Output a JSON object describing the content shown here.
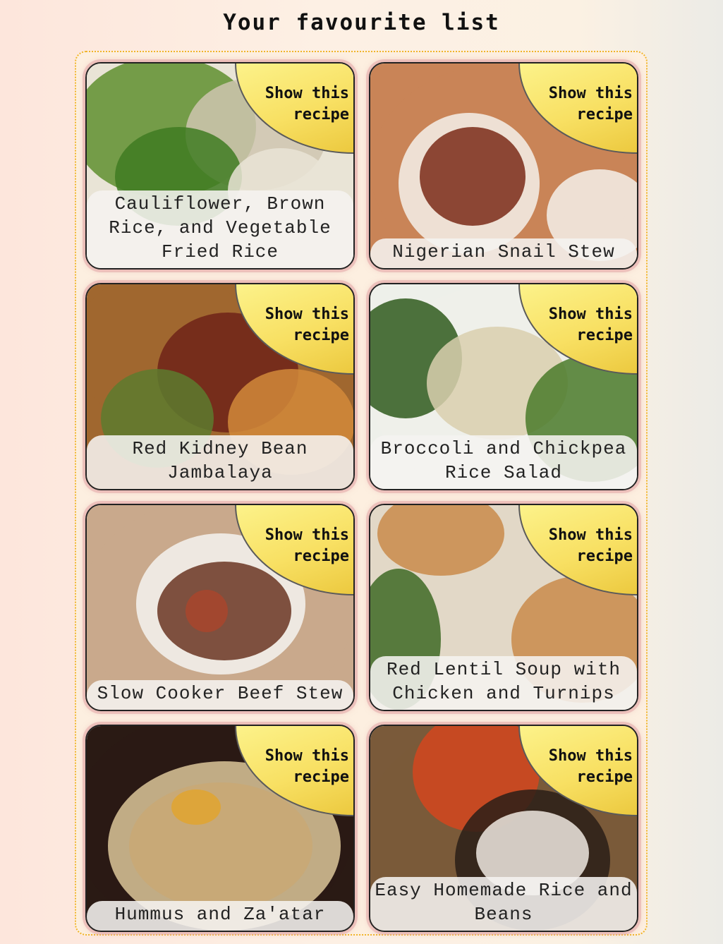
{
  "page": {
    "title": "Your favourite list"
  },
  "badge_label": "Show this\nrecipe",
  "recipes": [
    {
      "name": "Cauliflower, Brown Rice, and Vegetable Fried Rice",
      "palette": [
        "#e9e4d6",
        "#5f8f2f",
        "#cfc6b0",
        "#3f7b22"
      ]
    },
    {
      "name": "Nigerian Snail Stew",
      "palette": [
        "#c98457",
        "#7a2a18",
        "#f4f0ea",
        "#d9a873"
      ]
    },
    {
      "name": "Red Kidney Bean Jambalaya",
      "palette": [
        "#a0672f",
        "#6e2318",
        "#5d7b2e",
        "#d28a3a"
      ]
    },
    {
      "name": "Broccoli and Chickpea Rice Salad",
      "palette": [
        "#eef0ea",
        "#2f5a1d",
        "#d9cfae",
        "#4a7a2a"
      ]
    },
    {
      "name": "Slow Cooker Beef Stew",
      "palette": [
        "#c9a98c",
        "#6a3522",
        "#f5f3f0",
        "#a8452d"
      ]
    },
    {
      "name": "Red Lentil Soup with Chicken and Turnips",
      "palette": [
        "#e2d8c7",
        "#c98b4a",
        "#3e6a24",
        "#efe7d8"
      ]
    },
    {
      "name": "Hummus and Za'atar",
      "palette": [
        "#2a1a14",
        "#dcc799",
        "#c9a874",
        "#e1a52f"
      ]
    },
    {
      "name": "Easy Homemade Rice and Beans",
      "palette": [
        "#7a5a3a",
        "#d4471e",
        "#2a1e18",
        "#efe9e0"
      ]
    }
  ]
}
